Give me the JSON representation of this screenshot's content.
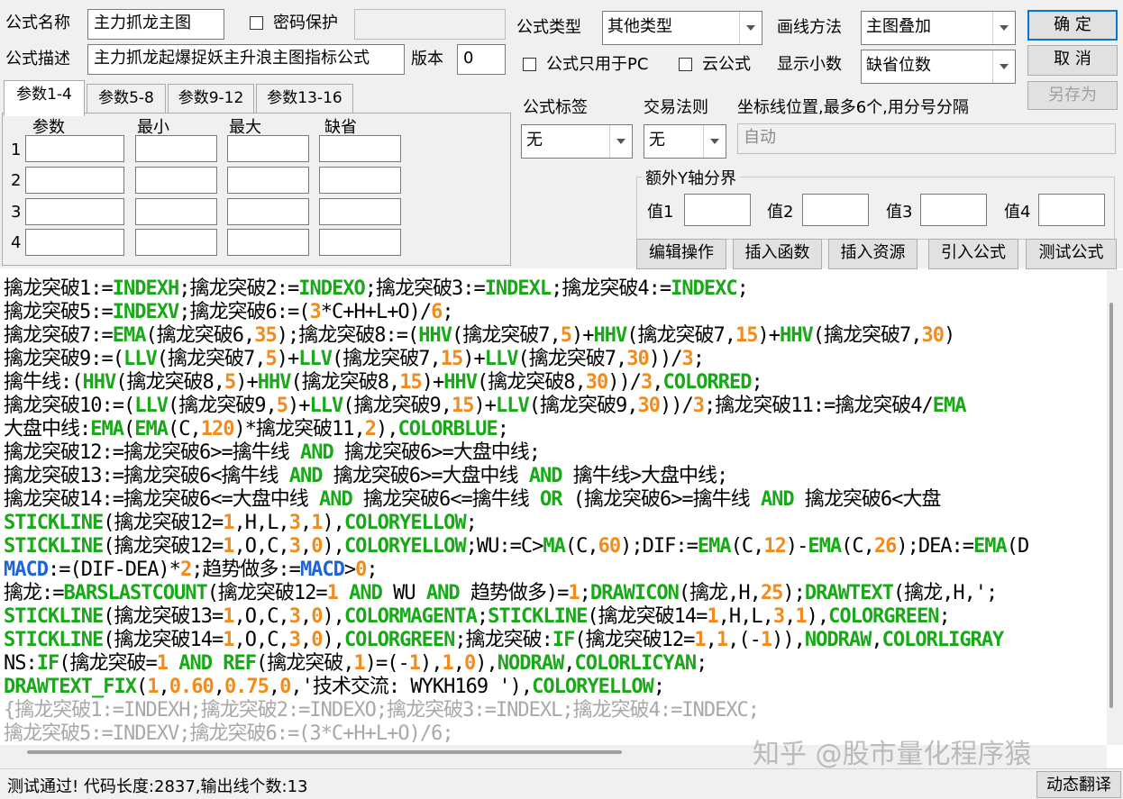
{
  "form": {
    "name_label": "公式名称",
    "name_value": "主力抓龙主图",
    "password_label": "密码保护",
    "desc_label": "公式描述",
    "desc_value": "主力抓龙起爆捉妖主升浪主图指标公式",
    "version_label": "版本",
    "version_value": "0",
    "type_label": "公式类型",
    "type_value": "其他类型",
    "draw_label": "画线方法",
    "draw_value": "主图叠加",
    "pc_only_label": "公式只用于PC",
    "cloud_label": "云公式",
    "decimals_label": "显示小数",
    "decimals_value": "缺省位数",
    "tag_label": "公式标签",
    "tag_value": "无",
    "trade_label": "交易法则",
    "trade_value": "无",
    "axis_label": "坐标线位置,最多6个,用分号分隔",
    "axis_value": "自动",
    "yaxis_group": "额外Y轴分界",
    "yaxis_values": [
      "值1",
      "值2",
      "值3",
      "值4"
    ]
  },
  "buttons": {
    "ok": "确  定",
    "cancel": "取  消",
    "save_as": "另存为",
    "edit_ops": "编辑操作",
    "insert_func": "插入函数",
    "insert_res": "插入资源",
    "import_formula": "引入公式",
    "test_formula": "测试公式",
    "translate": "动态翻译"
  },
  "params": {
    "tabs": [
      "参数1-4",
      "参数5-8",
      "参数9-12",
      "参数13-16"
    ],
    "headers": [
      "参数",
      "最小",
      "最大",
      "缺省"
    ],
    "rows": [
      "1",
      "2",
      "3",
      "4"
    ]
  },
  "code_lines": [
    [
      [
        "k",
        "擒龙突破1:="
      ],
      [
        "g",
        "INDEXH"
      ],
      [
        "k",
        ";擒龙突破2:="
      ],
      [
        "g",
        "INDEXO"
      ],
      [
        "k",
        ";擒龙突破3:="
      ],
      [
        "g",
        "INDEXL"
      ],
      [
        "k",
        ";擒龙突破4:="
      ],
      [
        "g",
        "INDEXC"
      ],
      [
        "k",
        ";"
      ]
    ],
    [
      [
        "k",
        "擒龙突破5:="
      ],
      [
        "g",
        "INDEXV"
      ],
      [
        "k",
        ";擒龙突破6:=("
      ],
      [
        "o",
        "3"
      ],
      [
        "k",
        "*C+H+L+O)/"
      ],
      [
        "o",
        "6"
      ],
      [
        "k",
        ";"
      ]
    ],
    [
      [
        "k",
        "擒龙突破7:="
      ],
      [
        "g",
        "EMA"
      ],
      [
        "k",
        "(擒龙突破6,"
      ],
      [
        "o",
        "35"
      ],
      [
        "k",
        ");擒龙突破8:=("
      ],
      [
        "g",
        "HHV"
      ],
      [
        "k",
        "(擒龙突破7,"
      ],
      [
        "o",
        "5"
      ],
      [
        "k",
        ")+"
      ],
      [
        "g",
        "HHV"
      ],
      [
        "k",
        "(擒龙突破7,"
      ],
      [
        "o",
        "15"
      ],
      [
        "k",
        ")+"
      ],
      [
        "g",
        "HHV"
      ],
      [
        "k",
        "(擒龙突破7,"
      ],
      [
        "o",
        "30"
      ],
      [
        "k",
        ")"
      ]
    ],
    [
      [
        "k",
        "擒龙突破9:=("
      ],
      [
        "g",
        "LLV"
      ],
      [
        "k",
        "(擒龙突破7,"
      ],
      [
        "o",
        "5"
      ],
      [
        "k",
        ")+"
      ],
      [
        "g",
        "LLV"
      ],
      [
        "k",
        "(擒龙突破7,"
      ],
      [
        "o",
        "15"
      ],
      [
        "k",
        ")+"
      ],
      [
        "g",
        "LLV"
      ],
      [
        "k",
        "(擒龙突破7,"
      ],
      [
        "o",
        "30"
      ],
      [
        "k",
        "))/"
      ],
      [
        "o",
        "3"
      ],
      [
        "k",
        ";"
      ]
    ],
    [
      [
        "k",
        "擒牛线:("
      ],
      [
        "g",
        "HHV"
      ],
      [
        "k",
        "(擒龙突破8,"
      ],
      [
        "o",
        "5"
      ],
      [
        "k",
        ")+"
      ],
      [
        "g",
        "HHV"
      ],
      [
        "k",
        "(擒龙突破8,"
      ],
      [
        "o",
        "15"
      ],
      [
        "k",
        ")+"
      ],
      [
        "g",
        "HHV"
      ],
      [
        "k",
        "(擒龙突破8,"
      ],
      [
        "o",
        "30"
      ],
      [
        "k",
        "))/"
      ],
      [
        "o",
        "3"
      ],
      [
        "k",
        ","
      ],
      [
        "g",
        "COLORRED"
      ],
      [
        "k",
        ";"
      ]
    ],
    [
      [
        "k",
        "擒龙突破10:=("
      ],
      [
        "g",
        "LLV"
      ],
      [
        "k",
        "(擒龙突破9,"
      ],
      [
        "o",
        "5"
      ],
      [
        "k",
        ")+"
      ],
      [
        "g",
        "LLV"
      ],
      [
        "k",
        "(擒龙突破9,"
      ],
      [
        "o",
        "15"
      ],
      [
        "k",
        ")+"
      ],
      [
        "g",
        "LLV"
      ],
      [
        "k",
        "(擒龙突破9,"
      ],
      [
        "o",
        "30"
      ],
      [
        "k",
        "))/"
      ],
      [
        "o",
        "3"
      ],
      [
        "k",
        ";擒龙突破11:=擒龙突破4/"
      ],
      [
        "g",
        "EMA"
      ]
    ],
    [
      [
        "k",
        "大盘中线:"
      ],
      [
        "g",
        "EMA"
      ],
      [
        "k",
        "("
      ],
      [
        "g",
        "EMA"
      ],
      [
        "k",
        "(C,"
      ],
      [
        "o",
        "120"
      ],
      [
        "k",
        ")*擒龙突破11,"
      ],
      [
        "o",
        "2"
      ],
      [
        "k",
        "),"
      ],
      [
        "g",
        "COLORBLUE"
      ],
      [
        "k",
        ";"
      ]
    ],
    [
      [
        "k",
        "擒龙突破12:=擒龙突破6>=擒牛线 "
      ],
      [
        "g",
        "AND"
      ],
      [
        "k",
        " 擒龙突破6>=大盘中线;"
      ]
    ],
    [
      [
        "k",
        "擒龙突破13:=擒龙突破6<擒牛线 "
      ],
      [
        "g",
        "AND"
      ],
      [
        "k",
        " 擒龙突破6>=大盘中线 "
      ],
      [
        "g",
        "AND"
      ],
      [
        "k",
        " 擒牛线>大盘中线;"
      ]
    ],
    [
      [
        "k",
        "擒龙突破14:=擒龙突破6<=大盘中线 "
      ],
      [
        "g",
        "AND"
      ],
      [
        "k",
        " 擒龙突破6<=擒牛线 "
      ],
      [
        "g",
        "OR"
      ],
      [
        "k",
        " (擒龙突破6>=擒牛线 "
      ],
      [
        "g",
        "AND"
      ],
      [
        "k",
        " 擒龙突破6<大盘"
      ]
    ],
    [
      [
        "g",
        "STICKLINE"
      ],
      [
        "k",
        "(擒龙突破12="
      ],
      [
        "o",
        "1"
      ],
      [
        "k",
        ",H,L,"
      ],
      [
        "o",
        "3"
      ],
      [
        "k",
        ","
      ],
      [
        "o",
        "1"
      ],
      [
        "k",
        "),"
      ],
      [
        "g",
        "COLORYELLOW"
      ],
      [
        "k",
        ";"
      ]
    ],
    [
      [
        "g",
        "STICKLINE"
      ],
      [
        "k",
        "(擒龙突破12="
      ],
      [
        "o",
        "1"
      ],
      [
        "k",
        ",O,C,"
      ],
      [
        "o",
        "3"
      ],
      [
        "k",
        ","
      ],
      [
        "o",
        "0"
      ],
      [
        "k",
        "),"
      ],
      [
        "g",
        "COLORYELLOW"
      ],
      [
        "k",
        ";WU:=C>"
      ],
      [
        "g",
        "MA"
      ],
      [
        "k",
        "(C,"
      ],
      [
        "o",
        "60"
      ],
      [
        "k",
        ");DIF:="
      ],
      [
        "g",
        "EMA"
      ],
      [
        "k",
        "(C,"
      ],
      [
        "o",
        "12"
      ],
      [
        "k",
        ")-"
      ],
      [
        "g",
        "EMA"
      ],
      [
        "k",
        "(C,"
      ],
      [
        "o",
        "26"
      ],
      [
        "k",
        ");DEA:="
      ],
      [
        "g",
        "EMA"
      ],
      [
        "k",
        "(D"
      ]
    ],
    [
      [
        "b",
        "MACD"
      ],
      [
        "k",
        ":=(DIF-DEA)*"
      ],
      [
        "o",
        "2"
      ],
      [
        "k",
        ";趋势做多:="
      ],
      [
        "b",
        "MACD"
      ],
      [
        "k",
        ">"
      ],
      [
        "o",
        "0"
      ],
      [
        "k",
        ";"
      ]
    ],
    [
      [
        "k",
        "擒龙:="
      ],
      [
        "g",
        "BARSLASTCOUNT"
      ],
      [
        "k",
        "(擒龙突破12="
      ],
      [
        "o",
        "1"
      ],
      [
        "k",
        " "
      ],
      [
        "g",
        "AND"
      ],
      [
        "k",
        " WU "
      ],
      [
        "g",
        "AND"
      ],
      [
        "k",
        " 趋势做多)="
      ],
      [
        "o",
        "1"
      ],
      [
        "k",
        ";"
      ],
      [
        "g",
        "DRAWICON"
      ],
      [
        "k",
        "(擒龙,H,"
      ],
      [
        "o",
        "25"
      ],
      [
        "k",
        ");"
      ],
      [
        "g",
        "DRAWTEXT"
      ],
      [
        "k",
        "(擒龙,H,';"
      ]
    ],
    [
      [
        "g",
        "STICKLINE"
      ],
      [
        "k",
        "(擒龙突破13="
      ],
      [
        "o",
        "1"
      ],
      [
        "k",
        ",O,C,"
      ],
      [
        "o",
        "3"
      ],
      [
        "k",
        ","
      ],
      [
        "o",
        "0"
      ],
      [
        "k",
        "),"
      ],
      [
        "g",
        "COLORMAGENTA"
      ],
      [
        "k",
        ";"
      ],
      [
        "g",
        "STICKLINE"
      ],
      [
        "k",
        "(擒龙突破14="
      ],
      [
        "o",
        "1"
      ],
      [
        "k",
        ",H,L,"
      ],
      [
        "o",
        "3"
      ],
      [
        "k",
        ","
      ],
      [
        "o",
        "1"
      ],
      [
        "k",
        "),"
      ],
      [
        "g",
        "COLORGREEN"
      ],
      [
        "k",
        ";"
      ]
    ],
    [
      [
        "g",
        "STICKLINE"
      ],
      [
        "k",
        "(擒龙突破14="
      ],
      [
        "o",
        "1"
      ],
      [
        "k",
        ",O,C,"
      ],
      [
        "o",
        "3"
      ],
      [
        "k",
        ","
      ],
      [
        "o",
        "0"
      ],
      [
        "k",
        "),"
      ],
      [
        "g",
        "COLORGREEN"
      ],
      [
        "k",
        ";擒龙突破:"
      ],
      [
        "g",
        "IF"
      ],
      [
        "k",
        "(擒龙突破12="
      ],
      [
        "o",
        "1"
      ],
      [
        "k",
        ","
      ],
      [
        "o",
        "1"
      ],
      [
        "k",
        ",(-"
      ],
      [
        "o",
        "1"
      ],
      [
        "k",
        ")),"
      ],
      [
        "g",
        "NODRAW"
      ],
      [
        "k",
        ","
      ],
      [
        "g",
        "COLORLIGRAY"
      ]
    ],
    [
      [
        "k",
        "NS:"
      ],
      [
        "g",
        "IF"
      ],
      [
        "k",
        "(擒龙突破="
      ],
      [
        "o",
        "1"
      ],
      [
        "k",
        " "
      ],
      [
        "g",
        "AND"
      ],
      [
        "k",
        " "
      ],
      [
        "g",
        "REF"
      ],
      [
        "k",
        "(擒龙突破,"
      ],
      [
        "o",
        "1"
      ],
      [
        "k",
        ")=(-"
      ],
      [
        "o",
        "1"
      ],
      [
        "k",
        "),"
      ],
      [
        "o",
        "1"
      ],
      [
        "k",
        ","
      ],
      [
        "o",
        "0"
      ],
      [
        "k",
        "),"
      ],
      [
        "g",
        "NODRAW"
      ],
      [
        "k",
        ","
      ],
      [
        "g",
        "COLORLICYAN"
      ],
      [
        "k",
        ";"
      ]
    ],
    [
      [
        "g",
        "DRAWTEXT_FIX"
      ],
      [
        "k",
        "("
      ],
      [
        "o",
        "1"
      ],
      [
        "k",
        ","
      ],
      [
        "o",
        "0.60"
      ],
      [
        "k",
        ","
      ],
      [
        "o",
        "0.75"
      ],
      [
        "k",
        ","
      ],
      [
        "o",
        "0"
      ],
      [
        "k",
        ",'技术交流: WYKH169 '),"
      ],
      [
        "g",
        "COLORYELLOW"
      ],
      [
        "k",
        ";"
      ]
    ],
    [
      [
        "f",
        "{擒龙突破1:=INDEXH;擒龙突破2:=INDEXO;擒龙突破3:=INDEXL;擒龙突破4:=INDEXC;"
      ]
    ],
    [
      [
        "f",
        "擒龙突破5:=INDEXV;擒龙突破6:=(3*C+H+L+O)/6;"
      ]
    ]
  ],
  "syntax_colors": {
    "k": "#000000",
    "g": "#18a818",
    "o": "#f08c1e",
    "b": "#1e64d2",
    "f": "#a8a8a8"
  },
  "status_text": "测试通过! 代码长度:2837,输出线个数:13",
  "watermark": "知乎 @股市量化程序猿"
}
